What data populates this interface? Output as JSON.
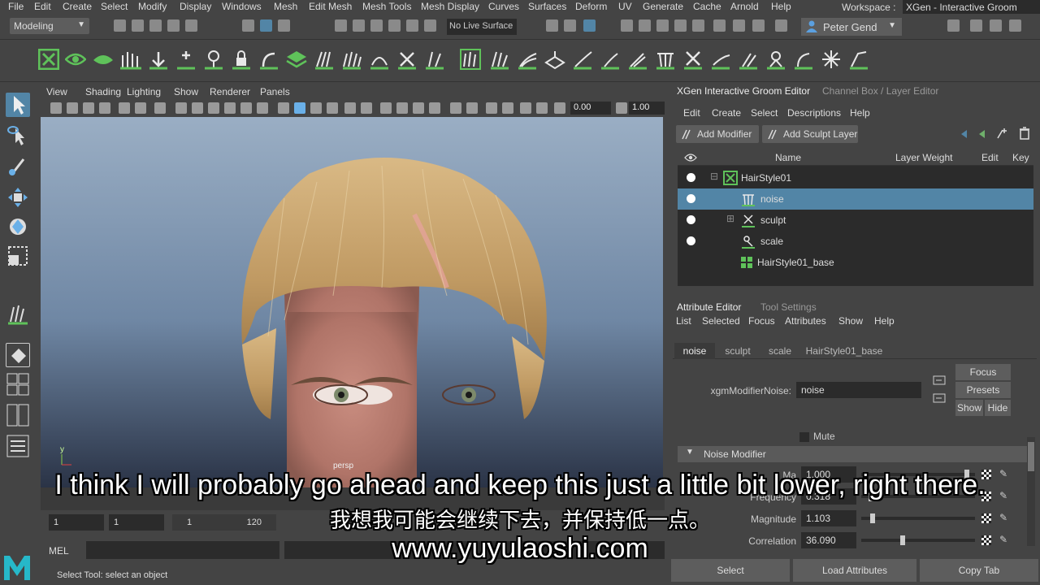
{
  "menubar": {
    "items": [
      "File",
      "Edit",
      "Create",
      "Select",
      "Modify",
      "Display",
      "Windows",
      "Mesh",
      "Edit Mesh",
      "Mesh Tools",
      "Mesh Display",
      "Curves",
      "Surfaces",
      "Deform",
      "UV",
      "Generate",
      "Cache",
      "Arnold",
      "Help"
    ],
    "workspace_label": "Workspace :",
    "workspace_value": "XGen - Interactive Groom"
  },
  "status_line": {
    "mode": "Modeling",
    "live_surface": "No Live Surface",
    "user": "Peter Gend"
  },
  "viewport": {
    "menu": [
      "View",
      "Shading",
      "Lighting",
      "Show",
      "Renderer",
      "Panels"
    ],
    "field_a": "0.00",
    "field_b": "1.00",
    "camera_label": "persp"
  },
  "range": {
    "start": "1",
    "playback_start": "1",
    "slider_start": "1",
    "slider_end": "120"
  },
  "command_line": {
    "language": "MEL"
  },
  "help_line": "Select Tool: select an object",
  "right_panel": {
    "tabs": [
      "XGen Interactive Groom Editor",
      "Channel Box / Layer Editor"
    ],
    "menu": [
      "Edit",
      "Create",
      "Select",
      "Descriptions",
      "Help"
    ],
    "add_modifier": "Add Modifier",
    "add_sculpt_layer": "Add Sculpt Layer",
    "outliner": {
      "columns": [
        "Name",
        "Layer Weight",
        "Edit",
        "Key"
      ],
      "rows": [
        {
          "name": "HairStyle01"
        },
        {
          "name": "noise"
        },
        {
          "name": "sculpt"
        },
        {
          "name": "scale"
        },
        {
          "name": "HairStyle01_base"
        }
      ]
    },
    "attribute_editor": {
      "tabs": [
        "Attribute Editor",
        "Tool Settings"
      ],
      "menu": [
        "List",
        "Selected",
        "Focus",
        "Attributes",
        "Show",
        "Help"
      ],
      "node_tabs": [
        "noise",
        "sculpt",
        "scale",
        "HairStyle01_base"
      ],
      "node_label": "xgmModifierNoise:",
      "node_value": "noise",
      "focus": "Focus",
      "presets": "Presets",
      "show": "Show",
      "hide": "Hide",
      "mute": "Mute",
      "section": "Noise Modifier",
      "attrs": [
        {
          "label": "Ma",
          "value": "1.000",
          "level": 0.95
        },
        {
          "label": "Frequency",
          "value": "0.318",
          "level": 0.07
        },
        {
          "label": "Magnitude",
          "value": "1.103",
          "level": 0.08
        },
        {
          "label": "Correlation",
          "value": "36.090",
          "level": 0.36
        }
      ],
      "buttons": [
        "Select",
        "Load Attributes",
        "Copy Tab"
      ]
    }
  },
  "subtitles": {
    "english": "I think I will probably go ahead and keep this just a little bit lower, right there.",
    "chinese": "我想我可能会继续下去，并保持低一点。",
    "url": "www.yuyulaoshi.com"
  },
  "colors": {
    "panel": "#444444",
    "field": "#2b2b2b",
    "selection": "#5285a6",
    "shelf_green": "#4fb04a"
  },
  "icons": [
    "pointer-icon",
    "lasso-icon",
    "paint-icon",
    "move-icon",
    "rotate-icon",
    "scale-icon",
    "xgen-icon",
    "eye-icon"
  ]
}
